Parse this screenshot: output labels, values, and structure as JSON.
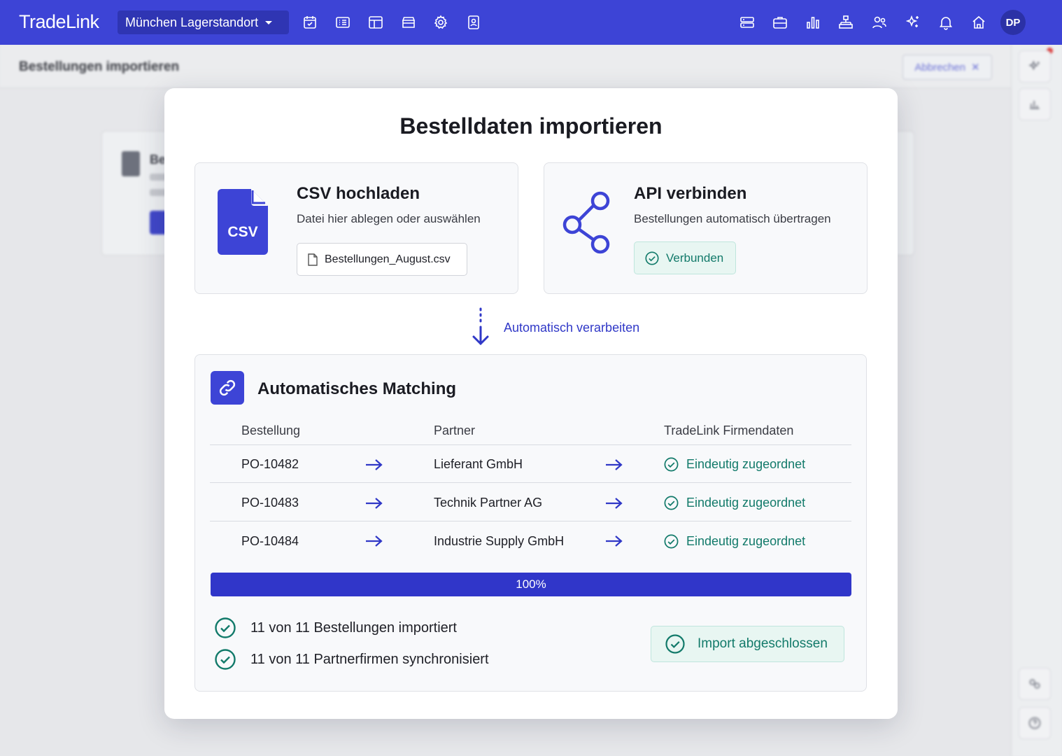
{
  "app": {
    "logo": "TradeLink",
    "location": "München Lagerstandort",
    "user_initials": "DP"
  },
  "nav_left_icons": [
    "calendar-check-icon",
    "list-icon",
    "layout-icon",
    "store-icon",
    "settings-icon",
    "contact-card-icon"
  ],
  "nav_right_icons": [
    "server-icon",
    "briefcase-icon",
    "bar-chart-icon",
    "hierarchy-icon",
    "users-icon",
    "sparkles-icon",
    "bell-icon",
    "home-icon"
  ],
  "background": {
    "page_title": "Bestellungen importieren",
    "cancel_label": "Abbrechen",
    "card_title": "Be"
  },
  "modal": {
    "title": "Bestelldaten importieren",
    "csv": {
      "title": "CSV hochladen",
      "subtitle": "Datei hier ablegen oder auswählen",
      "file_label": "CSV",
      "file_name": "Bestellungen_August.csv"
    },
    "api": {
      "title": "API verbinden",
      "subtitle": "Bestellungen automatisch übertragen",
      "status": "Verbunden"
    },
    "flow_label": "Automatisch verarbeiten",
    "matching": {
      "title": "Automatisches Matching",
      "headers": [
        "Bestellung",
        "Partner",
        "TradeLink Firmendaten"
      ],
      "rows": [
        {
          "order": "PO-10482",
          "partner": "Lieferant GmbH",
          "status": "Eindeutig zugeordnet"
        },
        {
          "order": "PO-10483",
          "partner": "Technik Partner AG",
          "status": "Eindeutig zugeordnet"
        },
        {
          "order": "PO-10484",
          "partner": "Industrie Supply GmbH",
          "status": "Eindeutig zugeordnet"
        }
      ],
      "progress_percent": 100,
      "progress_label": "100%",
      "summary": [
        "11 von 11 Bestellungen importiert",
        "11 von 11 Partnerfirmen synchronisiert"
      ],
      "done_label": "Import abgeschlossen"
    }
  },
  "colors": {
    "brand": "#3d44d6",
    "success": "#127a6a",
    "success_bg": "#e8f6f2"
  }
}
